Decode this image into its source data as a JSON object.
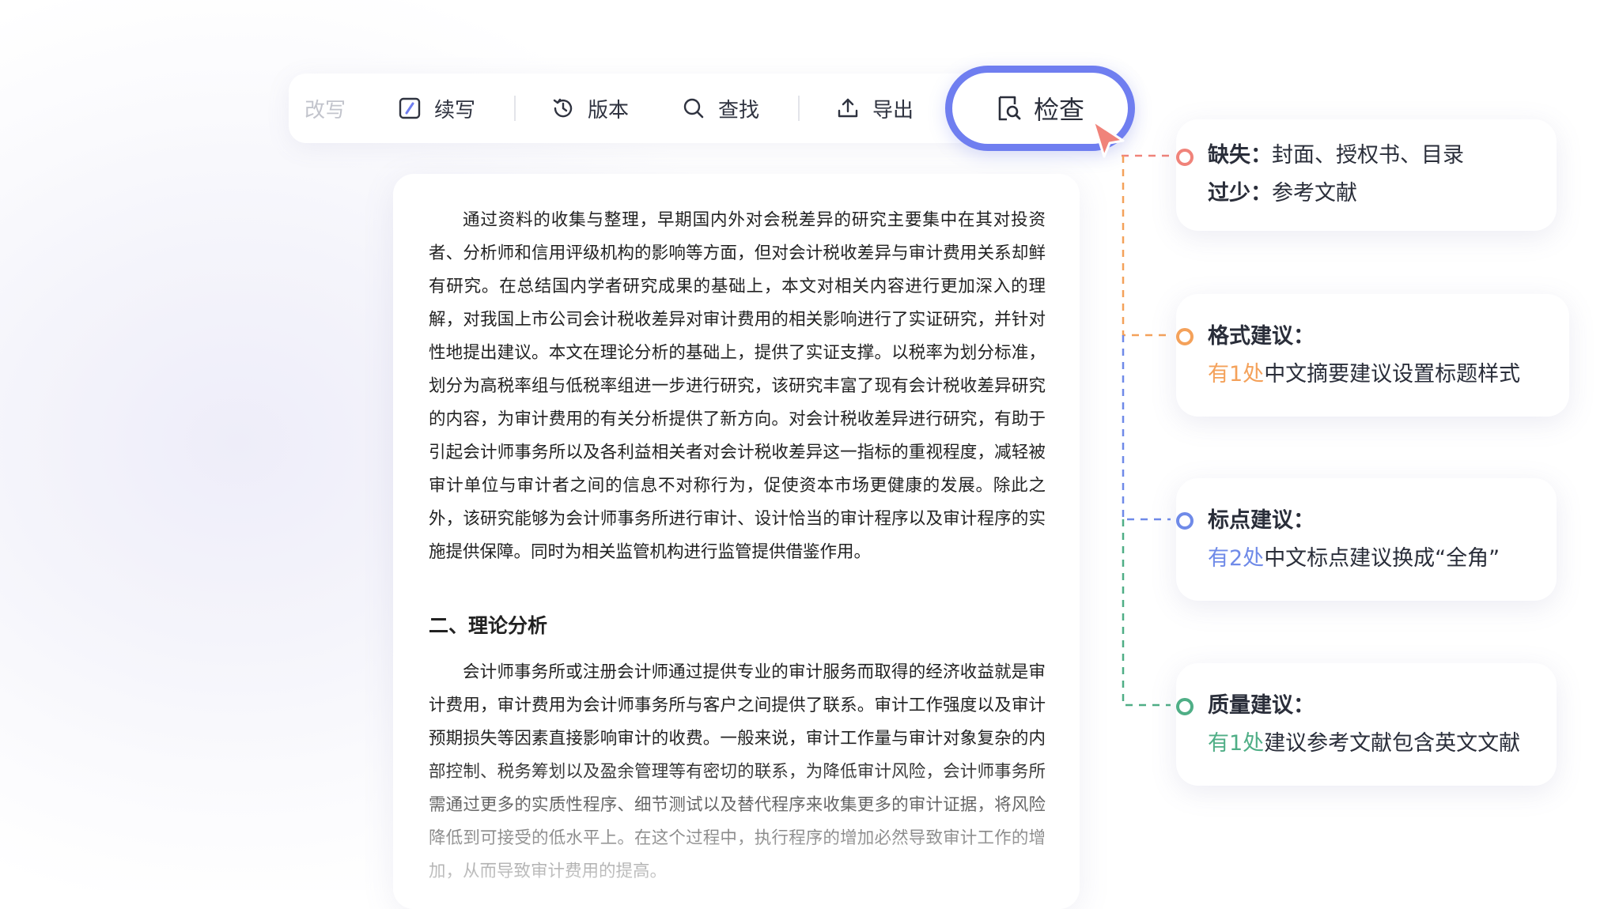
{
  "toolbar": {
    "items": [
      {
        "label": "改写",
        "icon": "rewrite-icon",
        "state": "faded"
      },
      {
        "label": "续写",
        "icon": "edit-pen-icon"
      },
      {
        "label": "版本",
        "icon": "history-icon"
      },
      {
        "label": "查找",
        "icon": "search-icon"
      },
      {
        "label": "导出",
        "icon": "upload-export-icon"
      }
    ],
    "check": {
      "label": "检查",
      "icon": "doc-search-icon",
      "accent": "#6f7ef0"
    }
  },
  "document": {
    "paragraph1": "通过资料的收集与整理，早期国内外对会税差异的研究主要集中在其对投资者、分析师和信用评级机构的影响等方面，但对会计税收差异与审计费用关系却鲜有研究。在总结国内学者研究成果的基础上，本文对相关内容进行更加深入的理解，对我国上市公司会计税收差异对审计费用的相关影响进行了实证研究，并针对性地提出建议。本文在理论分析的基础上，提供了实证支撑。以税率为划分标准，划分为高税率组与低税率组进一步进行研究，该研究丰富了现有会计税收差异研究的内容，为审计费用的有关分析提供了新方向。对会计税收差异进行研究，有助于引起会计师事务所以及各利益相关者对会计税收差异这一指标的重视程度，减轻被审计单位与审计者之间的信息不对称行为，促使资本市场更健康的发展。除此之外，该研究能够为会计师事务所进行审计、设计恰当的审计程序以及审计程序的实施提供保障。同时为相关监管机构进行监管提供借鉴作用。",
    "heading": "二、理论分析",
    "paragraph2": "会计师事务所或注册会计师通过提供专业的审计服务而取得的经济收益就是审计费用，审计费用为会计师事务所与客户之间提供了联系。审计工作强度以及审计预期损失等因素直接影响审计的收费。一般来说，审计工作量与审计对象复杂的内部控制、税务筹划以及盈余管理等有密切的联系，为降低审计风险，会计师事务所需通过更多的实质性程序、细节测试以及替代程序来收集更多的审计证据，将风险降低到可接受的低水平上。在这个过程中，执行程序的增加必然导致审计工作的增加，从而导致审计费用的提高。"
  },
  "results": [
    {
      "color": "#f0837a",
      "line1_title": "缺失",
      "line1_colon": "：",
      "line1_text": "封面、授权书、目录",
      "line2_title": "过少",
      "line2_colon": "：",
      "line2_text": "参考文献"
    },
    {
      "color": "#f4a15a",
      "title": "格式建议：",
      "count": "有1处",
      "text": "中文摘要建议设置标题样式"
    },
    {
      "color": "#6f8ae8",
      "title": "标点建议：",
      "count": "有2处",
      "text": "中文标点建议换成“全角”"
    },
    {
      "color": "#4fae86",
      "title": "质量建议：",
      "count": "有1处",
      "text": "建议参考文献包含英文文献"
    }
  ]
}
